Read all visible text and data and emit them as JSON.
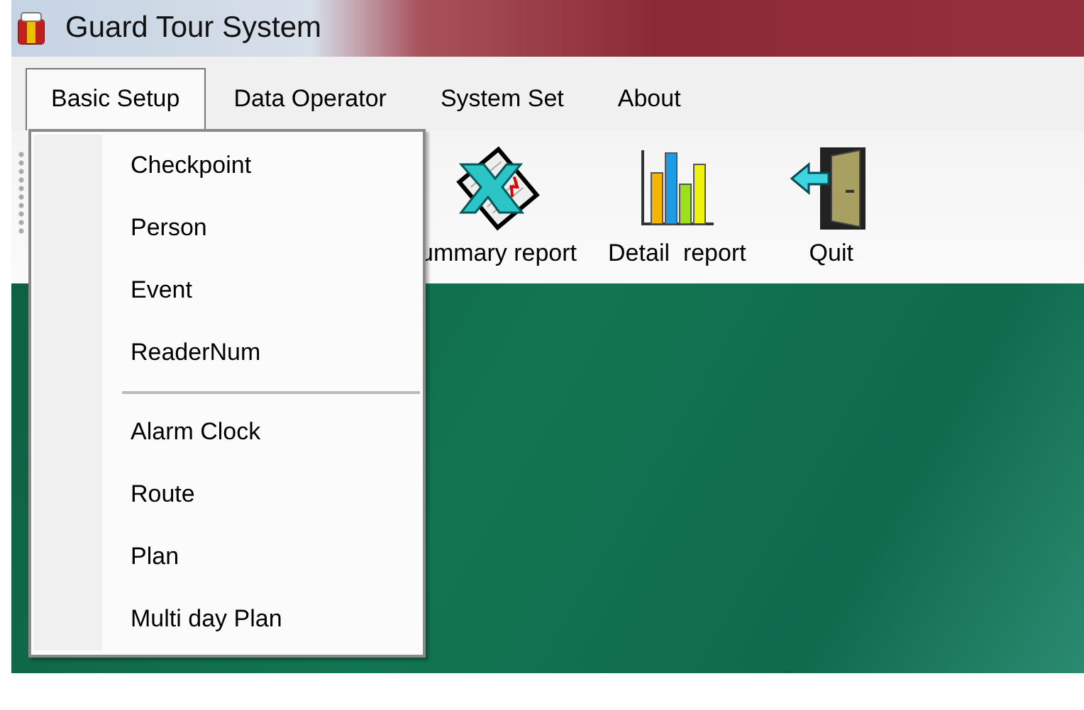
{
  "window": {
    "title": "Guard Tour System"
  },
  "menu_bar": [
    {
      "label": "Basic Setup",
      "selected": true
    },
    {
      "label": "Data Operator",
      "selected": false
    },
    {
      "label": "System Set",
      "selected": false
    },
    {
      "label": "About",
      "selected": false
    }
  ],
  "dropdown": [
    {
      "kind": "item",
      "label": "Checkpoint"
    },
    {
      "kind": "item",
      "label": "Person"
    },
    {
      "kind": "item",
      "label": "Event"
    },
    {
      "kind": "item",
      "label": "ReaderNum"
    },
    {
      "kind": "separator"
    },
    {
      "kind": "item",
      "label": "Alarm Clock"
    },
    {
      "kind": "item",
      "label": "Route"
    },
    {
      "kind": "item",
      "label": "Plan"
    },
    {
      "kind": "item",
      "label": "Multi day Plan"
    }
  ],
  "toolbar": [
    {
      "kind": "spreadsheet",
      "label": "ummary report"
    },
    {
      "kind": "chart",
      "label": "Detail  report"
    },
    {
      "kind": "door",
      "label": "Quit"
    }
  ]
}
